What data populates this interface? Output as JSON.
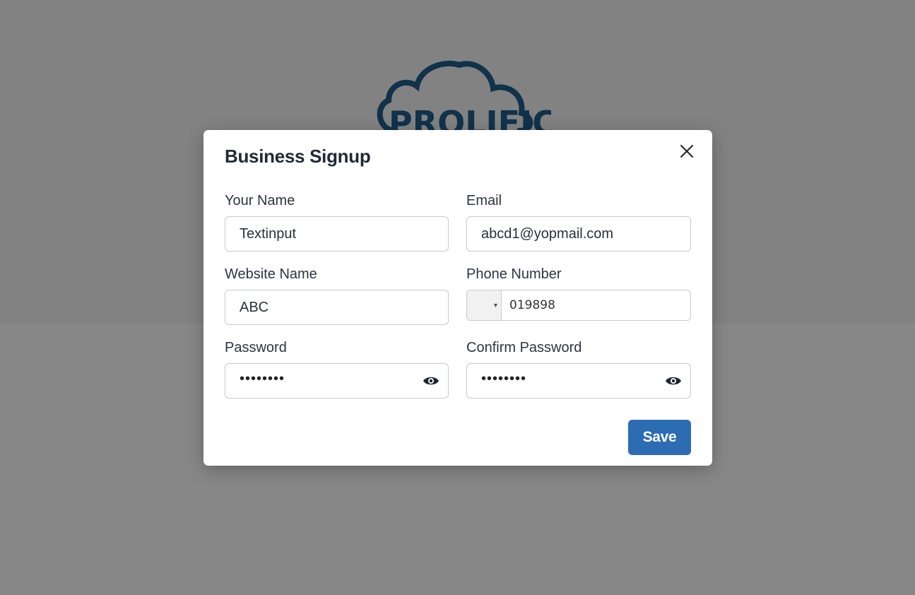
{
  "modal": {
    "title": "Business Signup"
  },
  "fields": {
    "your_name": {
      "label": "Your Name",
      "value": "Textinput"
    },
    "email": {
      "label": "Email",
      "value": "abcd1@yopmail.com"
    },
    "website_name": {
      "label": "Website Name",
      "value": "ABC"
    },
    "phone_number": {
      "label": "Phone Number",
      "value": "019898"
    },
    "password": {
      "label": "Password",
      "value": "••••••••"
    },
    "confirm_password": {
      "label": "Confirm Password",
      "value": "••••••••"
    }
  },
  "actions": {
    "save_label": "Save"
  },
  "background": {
    "logo_text": "PROLIFIC"
  },
  "icons": {
    "close": "close-icon",
    "eye": "eye-icon",
    "dropdown": "chevron-down-icon"
  },
  "colors": {
    "accent": "#2c6cb3",
    "logo_blue": "#1f5f8f"
  }
}
